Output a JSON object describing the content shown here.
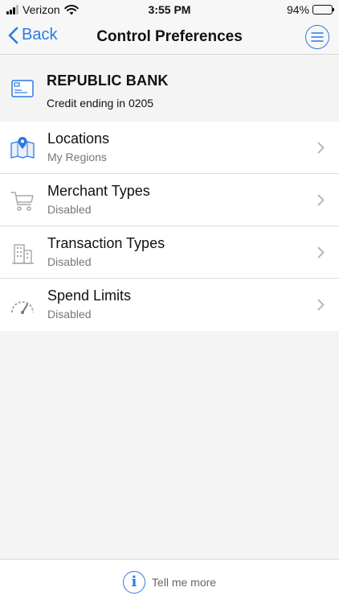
{
  "status_bar": {
    "carrier": "Verizon",
    "time": "3:55 PM",
    "battery": "94%",
    "battery_level": 0.94
  },
  "nav": {
    "back_label": "Back",
    "title": "Control Preferences",
    "menu_icon": "hamburger-menu-icon"
  },
  "card": {
    "bank_name": "REPUBLIC BANK",
    "subtitle": "Credit ending in 0205",
    "icon": "credit-card-icon"
  },
  "items": [
    {
      "title": "Locations",
      "subtitle": "My Regions",
      "icon": "map-pin-icon"
    },
    {
      "title": "Merchant Types",
      "subtitle": "Disabled",
      "icon": "shopping-cart-icon"
    },
    {
      "title": "Transaction Types",
      "subtitle": "Disabled",
      "icon": "buildings-icon"
    },
    {
      "title": "Spend Limits",
      "subtitle": "Disabled",
      "icon": "gauge-icon"
    }
  ],
  "footer": {
    "label": "Tell me more",
    "icon": "info-icon"
  },
  "colors": {
    "accent": "#2a7ae2",
    "muted": "#777777"
  }
}
